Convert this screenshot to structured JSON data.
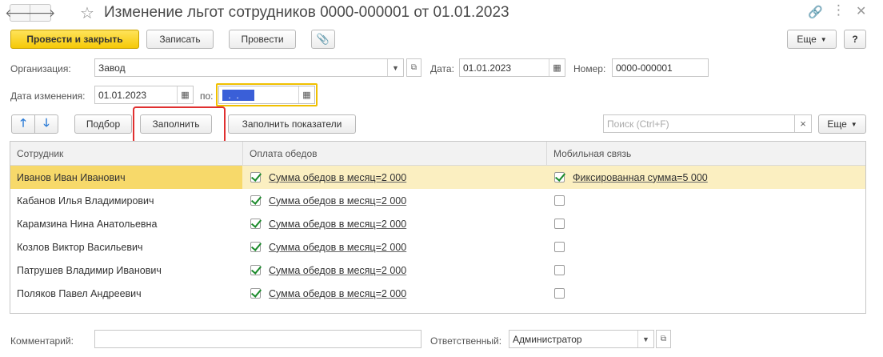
{
  "window": {
    "title": "Изменение льгот сотрудников 0000-000001 от 01.01.2023",
    "back_icon": "arrow-left-icon",
    "forward_icon": "arrow-right-icon"
  },
  "toolbar": {
    "post_close_label": "Провести и закрыть",
    "save_label": "Записать",
    "post_label": "Провести",
    "more_label": "Еще",
    "help_label": "?"
  },
  "header": {
    "organization_label": "Организация:",
    "organization_value": "Завод",
    "date_label": "Дата:",
    "date_value": "01.01.2023",
    "number_label": "Номер:",
    "number_value": "0000-000001",
    "change_date_label": "Дата изменения:",
    "change_date_value": "01.01.2023",
    "to_label": "по:",
    "to_value": " .  . "
  },
  "table_toolbar": {
    "pick_label": "Подбор",
    "fill_label": "Заполнить",
    "fill_indicators_label": "Заполнить показатели",
    "search_placeholder": "Поиск (Ctrl+F)",
    "clear_label": "×",
    "more_label": "Еще"
  },
  "table": {
    "columns": [
      "Сотрудник",
      "Оплата обедов",
      "Мобильная связь"
    ],
    "rows": [
      {
        "name": "Иванов Иван Иванович",
        "lunch_checked": true,
        "lunch": "Сумма обедов в месяц=2 000",
        "mobile_checked": true,
        "mobile": "Фиксированная сумма=5 000",
        "selected": true
      },
      {
        "name": "Кабанов Илья Владимирович",
        "lunch_checked": true,
        "lunch": "Сумма обедов в месяц=2 000",
        "mobile_checked": false,
        "mobile": "",
        "selected": false
      },
      {
        "name": "Карамзина Нина Анатольевна",
        "lunch_checked": true,
        "lunch": "Сумма обедов в месяц=2 000",
        "mobile_checked": false,
        "mobile": "",
        "selected": false
      },
      {
        "name": "Козлов Виктор Васильевич",
        "lunch_checked": true,
        "lunch": "Сумма обедов в месяц=2 000",
        "mobile_checked": false,
        "mobile": "",
        "selected": false
      },
      {
        "name": "Патрушев Владимир Иванович",
        "lunch_checked": true,
        "lunch": "Сумма обедов в месяц=2 000",
        "mobile_checked": false,
        "mobile": "",
        "selected": false
      },
      {
        "name": "Поляков Павел Андреевич",
        "lunch_checked": true,
        "lunch": "Сумма обедов в месяц=2 000",
        "mobile_checked": false,
        "mobile": "",
        "selected": false
      }
    ]
  },
  "footer": {
    "comment_label": "Комментарий:",
    "comment_value": "",
    "responsible_label": "Ответственный:",
    "responsible_value": "Администратор"
  },
  "colors": {
    "primary_button": "#f5c907",
    "selected_row": "#fbefc1",
    "highlight": "#e03030",
    "focus_border": "#f0c000"
  }
}
